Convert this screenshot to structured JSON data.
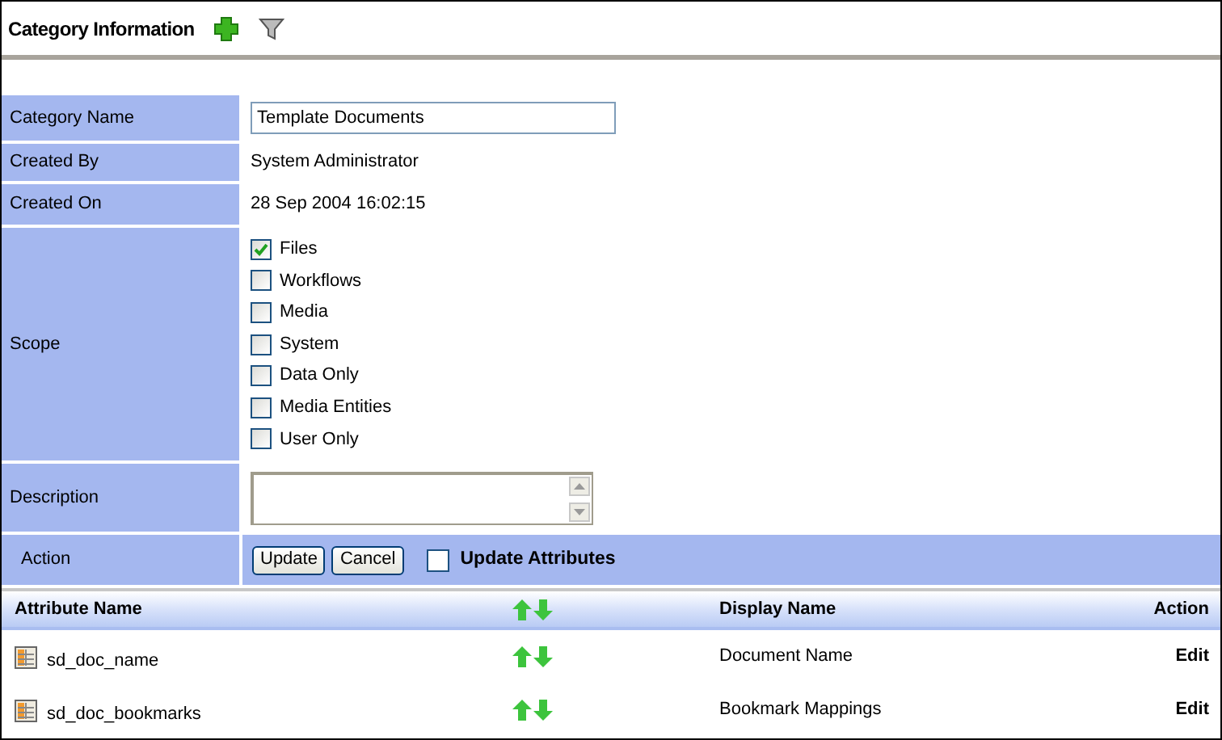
{
  "header": {
    "title": "Category Information"
  },
  "form": {
    "category_name": {
      "label": "Category Name",
      "value": "Template Documents"
    },
    "created_by": {
      "label": "Created By",
      "value": "System Administrator"
    },
    "created_on": {
      "label": "Created On",
      "value": "28 Sep 2004 16:02:15"
    },
    "scope": {
      "label": "Scope",
      "options": [
        {
          "label": "Files",
          "checked": true
        },
        {
          "label": "Workflows",
          "checked": false
        },
        {
          "label": "Media",
          "checked": false
        },
        {
          "label": "System",
          "checked": false
        },
        {
          "label": "Data Only",
          "checked": false
        },
        {
          "label": "Media Entities",
          "checked": false
        },
        {
          "label": "User Only",
          "checked": false
        }
      ]
    },
    "description": {
      "label": "Description"
    },
    "action": {
      "label": "Action",
      "buttons": [
        "Update",
        "Cancel"
      ],
      "update_attributes": {
        "label": "Update Attributes",
        "checked": false
      }
    }
  },
  "table": {
    "columns": [
      "Attribute Name",
      "Display Name",
      "Action"
    ],
    "rows": [
      {
        "attribute_name": "sd_doc_name",
        "display_name": "Document Name",
        "action": "Edit"
      },
      {
        "attribute_name": "sd_doc_bookmarks",
        "display_name": "Bookmark Mappings",
        "action": "Edit"
      }
    ]
  }
}
